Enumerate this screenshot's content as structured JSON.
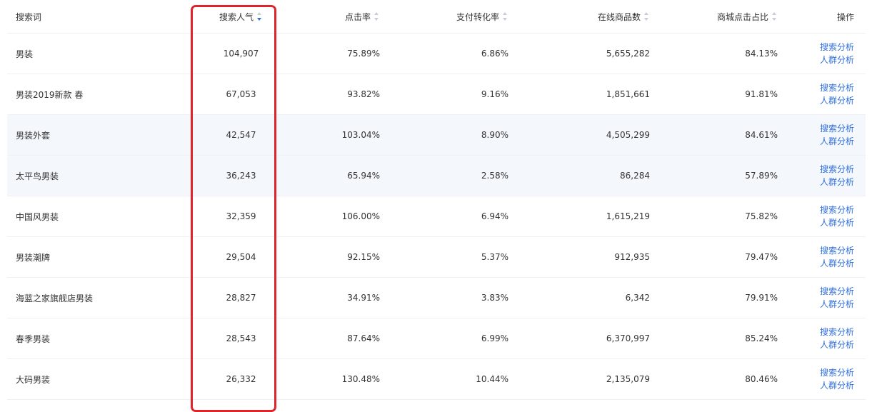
{
  "colors": {
    "accent": "#2f6fd9",
    "highlight": "#e0242b",
    "stripe": "#f4f8fd"
  },
  "table": {
    "headers": {
      "keyword": "搜索词",
      "popularity": "搜索人气",
      "ctr": "点击率",
      "conversion": "支付转化率",
      "online_products": "在线商品数",
      "mall_click_share": "商城点击占比",
      "action": "操作"
    },
    "action_labels": {
      "search_analysis": "搜索分析",
      "crowd_analysis": "人群分析"
    },
    "rows": [
      {
        "keyword": "男装",
        "popularity": "104,907",
        "ctr": "75.89%",
        "conversion": "6.86%",
        "online_products": "5,655,282",
        "mall_click_share": "84.13%"
      },
      {
        "keyword": "男装2019新款 春",
        "popularity": "67,053",
        "ctr": "93.82%",
        "conversion": "9.16%",
        "online_products": "1,851,661",
        "mall_click_share": "91.81%"
      },
      {
        "keyword": "男装外套",
        "popularity": "42,547",
        "ctr": "103.04%",
        "conversion": "8.90%",
        "online_products": "4,505,299",
        "mall_click_share": "84.61%"
      },
      {
        "keyword": "太平鸟男装",
        "popularity": "36,243",
        "ctr": "65.94%",
        "conversion": "2.58%",
        "online_products": "86,284",
        "mall_click_share": "57.89%"
      },
      {
        "keyword": "中国风男装",
        "popularity": "32,359",
        "ctr": "106.00%",
        "conversion": "6.94%",
        "online_products": "1,615,219",
        "mall_click_share": "75.82%"
      },
      {
        "keyword": "男装潮牌",
        "popularity": "29,504",
        "ctr": "92.15%",
        "conversion": "5.37%",
        "online_products": "912,935",
        "mall_click_share": "79.47%"
      },
      {
        "keyword": "海蓝之家旗舰店男装",
        "popularity": "28,827",
        "ctr": "34.91%",
        "conversion": "3.83%",
        "online_products": "6,342",
        "mall_click_share": "79.91%"
      },
      {
        "keyword": "春季男装",
        "popularity": "28,543",
        "ctr": "87.64%",
        "conversion": "6.99%",
        "online_products": "6,370,997",
        "mall_click_share": "85.24%"
      },
      {
        "keyword": "大码男装",
        "popularity": "26,332",
        "ctr": "130.48%",
        "conversion": "10.44%",
        "online_products": "2,135,079",
        "mall_click_share": "80.46%"
      }
    ]
  }
}
